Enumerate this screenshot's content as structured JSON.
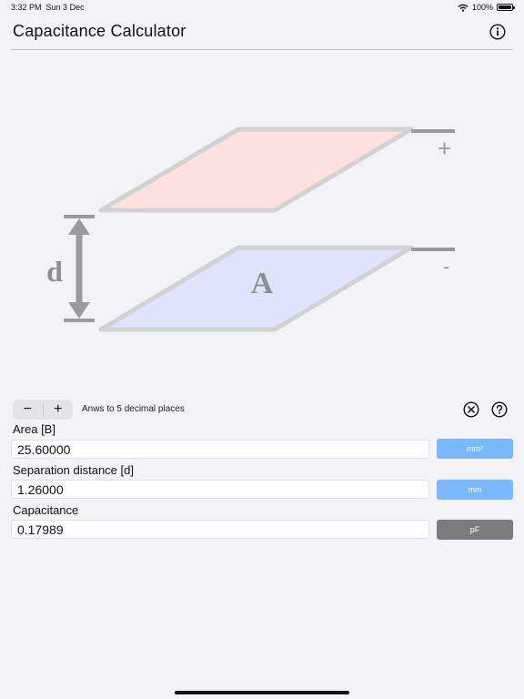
{
  "status": {
    "time": "3:32 PM",
    "date": "Sun 3 Dec",
    "battery": "100%"
  },
  "header": {
    "title": "Capacitance Calculator",
    "info_icon": "info-circle-icon"
  },
  "diagram": {
    "distance_label": "d",
    "area_label": "A",
    "plus_sign": "+",
    "minus_sign": "-",
    "colors": {
      "top_plate": "#fde0e0",
      "bottom_plate": "#dfe3fb",
      "outline": "#d2d2d2",
      "arrow": "#9b9b9b"
    }
  },
  "controls": {
    "decrement_label": "−",
    "increment_label": "+",
    "precision_text": "Anws to 5 decimal places",
    "clear_icon": "clear-circle-icon",
    "help_icon": "help-circle-icon"
  },
  "fields": {
    "area": {
      "label": "Area [B]",
      "value": "25.60000",
      "unit": "mm²",
      "unit_color": "#7ab8fb"
    },
    "separation": {
      "label": "Separation distance [d]",
      "value": "1.26000",
      "unit": "mm",
      "unit_color": "#7ab8fb"
    },
    "capacitance": {
      "label": "Capacitance",
      "value": "0.17989",
      "unit": "pF",
      "unit_color": "#7b7b7b"
    }
  }
}
